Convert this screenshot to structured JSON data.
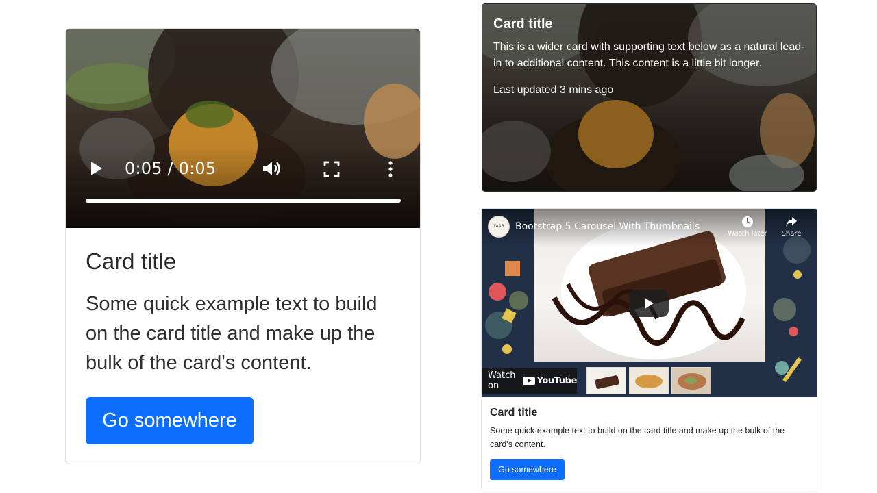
{
  "card_video": {
    "time": "0:05 / 0:05",
    "title": "Card title",
    "text": "Some quick example text to build on the card title and make up the bulk of the card's content.",
    "button": "Go somewhere",
    "progress": 1.0
  },
  "card_overlay": {
    "title": "Card title",
    "text": "This is a wider card with supporting text below as a natural lead-in to additional content. This content is a little bit longer.",
    "updated": "Last updated 3 mins ago"
  },
  "card_youtube": {
    "video_title": "Bootstrap 5 Carousel With Thumbnails",
    "watch_later": "Watch later",
    "share": "Share",
    "watch_on": "Watch on",
    "youtube": "YouTube",
    "title": "Card title",
    "text": "Some quick example text to build on the card title and make up the bulk of the card's content.",
    "button": "Go somewhere"
  },
  "colors": {
    "primary": "#0d6efd",
    "text": "#212529"
  }
}
